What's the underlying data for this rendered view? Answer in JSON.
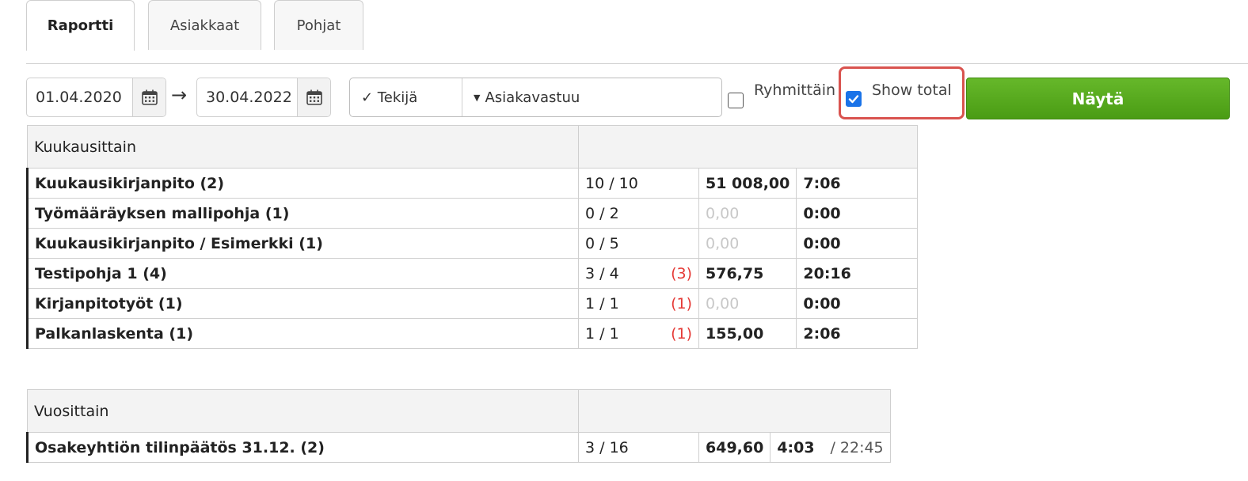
{
  "tabs": [
    {
      "label": "Raportti",
      "active": true
    },
    {
      "label": "Asiakkaat",
      "active": false
    },
    {
      "label": "Pohjat",
      "active": false
    }
  ],
  "filters": {
    "date_from": "01.04.2020",
    "date_to": "30.04.2022",
    "arrow": "→",
    "tekija": "✓ Tekijä",
    "asiakasvastuu": "Asiakavastuu",
    "ryhmittain_label": "Ryhmittäin",
    "ryhmittain_checked": false,
    "show_total_label": "Show total",
    "show_total_checked": true,
    "show_button": "Näytä"
  },
  "monthly": {
    "header": "Kuukausittain",
    "rows": [
      {
        "name": "Kuukausikirjanpito (2)",
        "ratio": "10 / 10",
        "flag": "",
        "amount": "51 008,00",
        "time": "7:06"
      },
      {
        "name": "Työmääräyksen mallipohja (1)",
        "ratio": "0 / 2",
        "flag": "",
        "amount": "0,00",
        "time": "0:00"
      },
      {
        "name": "Kuukausikirjanpito / Esimerkki (1)",
        "ratio": "0 / 5",
        "flag": "",
        "amount": "0,00",
        "time": "0:00"
      },
      {
        "name": "Testipohja 1 (4)",
        "ratio": "3 / 4",
        "flag": "(3)",
        "amount": "576,75",
        "time": "20:16"
      },
      {
        "name": "Kirjanpitotyöt (1)",
        "ratio": "1 / 1",
        "flag": "(1)",
        "amount": "0,00",
        "time": "0:00"
      },
      {
        "name": "Palkanlaskenta (1)",
        "ratio": "1 / 1",
        "flag": "(1)",
        "amount": "155,00",
        "time": "2:06"
      }
    ]
  },
  "yearly": {
    "header": "Vuosittain",
    "rows": [
      {
        "name": "Osakeyhtiön tilinpäätös 31.12. (2)",
        "ratio": "3 / 16",
        "amount": "649,60",
        "time": "4:03",
        "total": "/ 22:45"
      }
    ]
  },
  "icons": {
    "calendar": "calendar-icon",
    "checkmark": "checkmark-icon",
    "caret": "caret-down-icon"
  },
  "colors": {
    "accent_green": "#5aaa1f",
    "flag_red": "#e53935",
    "highlight_red": "#d9534f",
    "checkbox_blue": "#1a73e8"
  }
}
